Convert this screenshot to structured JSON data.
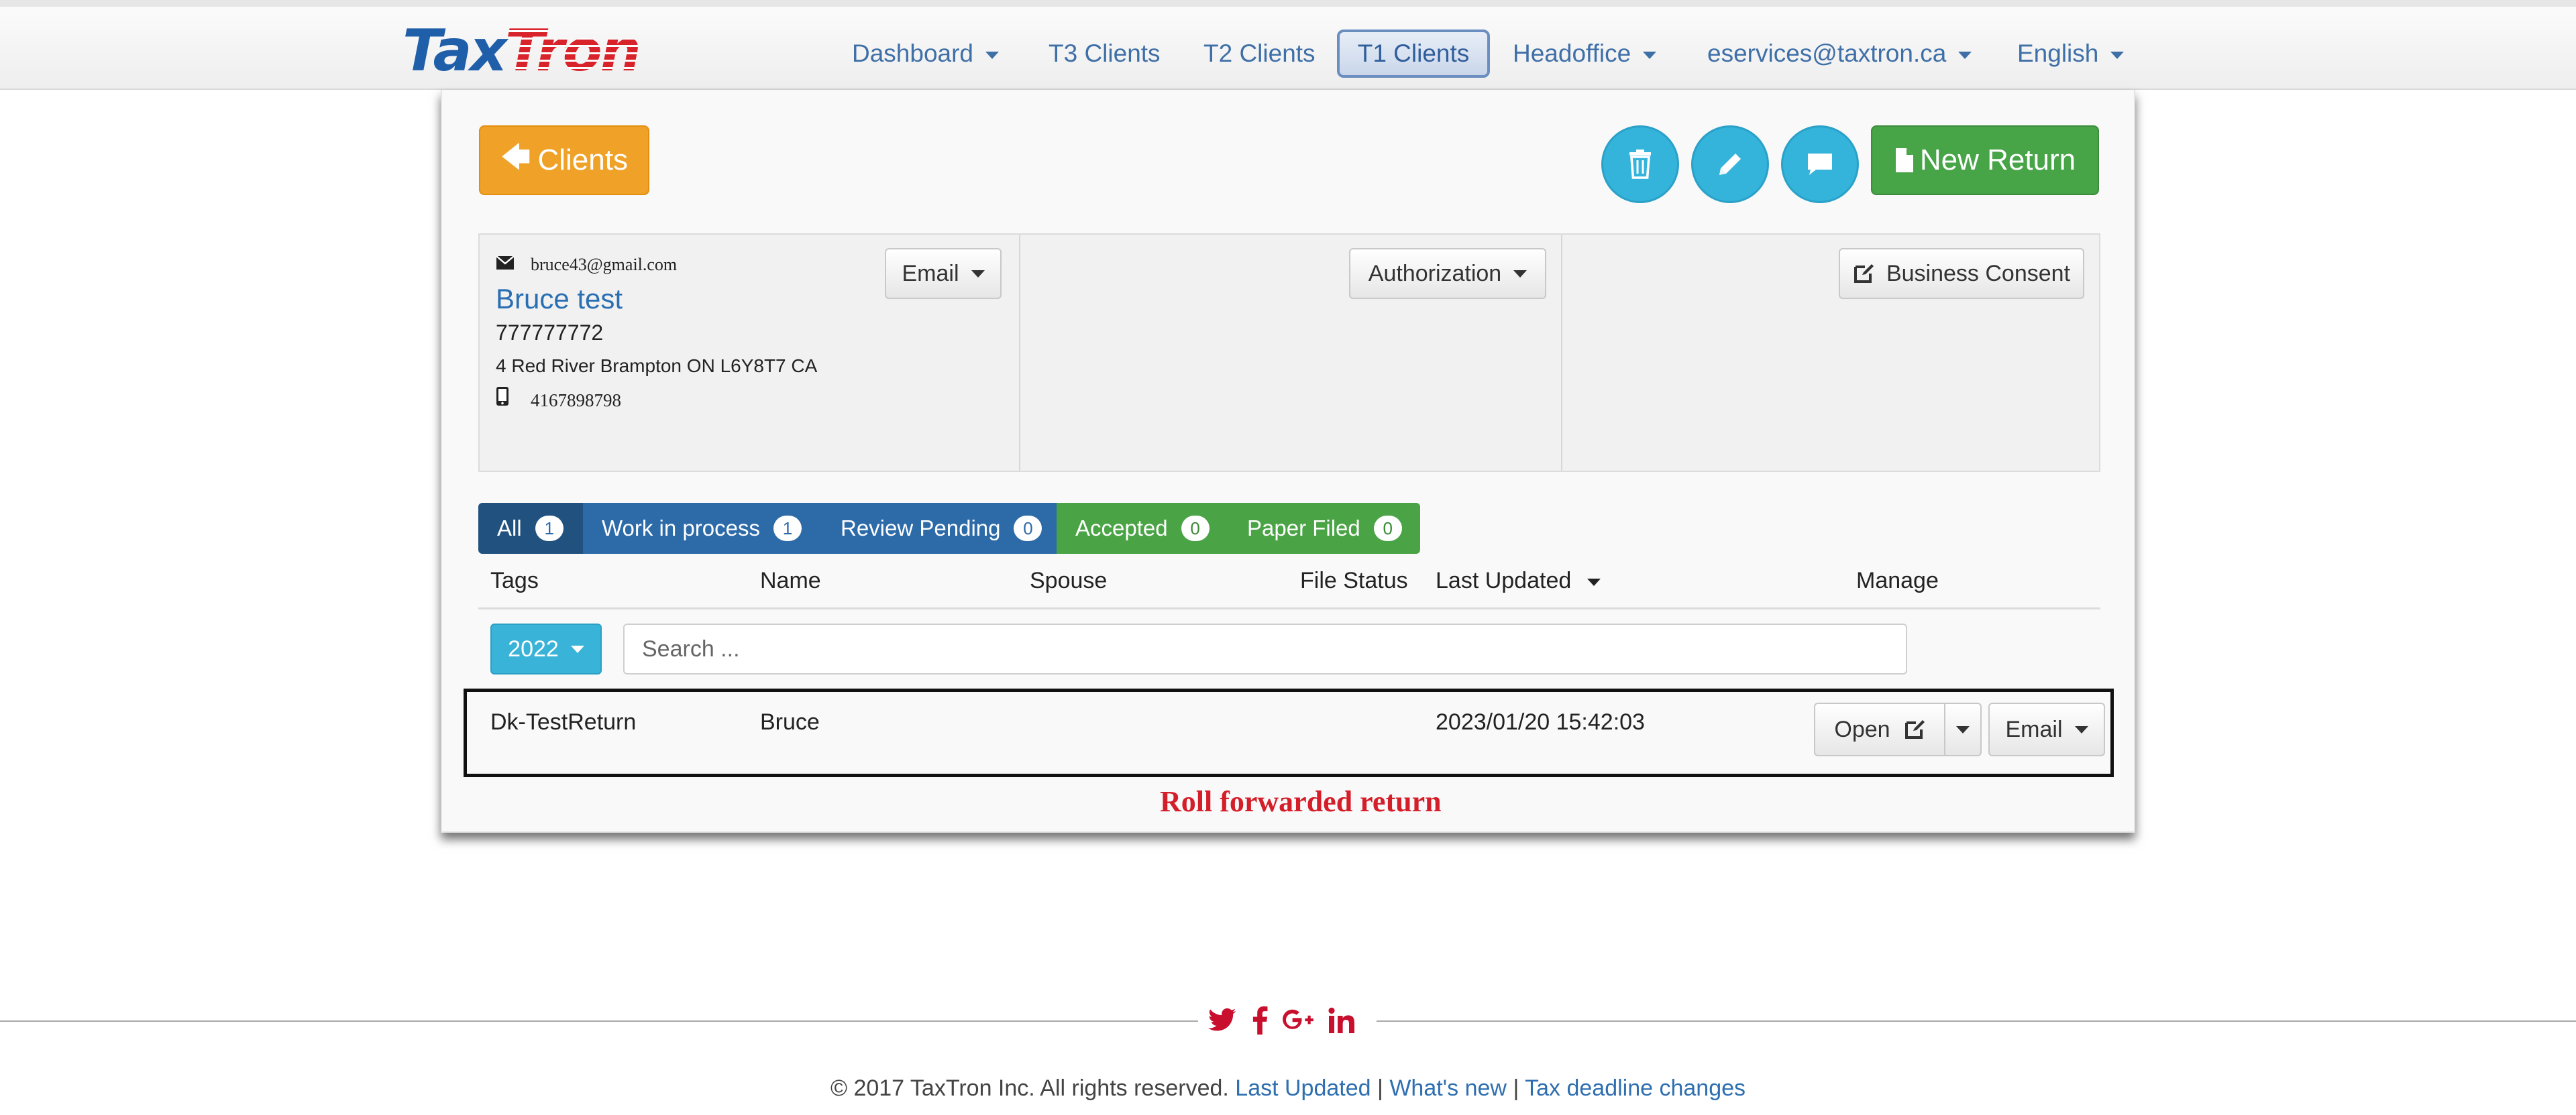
{
  "colors": {
    "brand_blue": "#1f5ea8",
    "brand_red": "#d8232a",
    "orange": "#f0a228",
    "info": "#34b3db",
    "success": "#47a447",
    "primary": "#2c6aa8",
    "annotation_red": "#d41f2a"
  },
  "navbar": {
    "logo": {
      "part1": "Tax",
      "part2": "Tron"
    },
    "items": [
      {
        "label": "Dashboard",
        "dropdown": true
      },
      {
        "label": "T3 Clients",
        "dropdown": false
      },
      {
        "label": "T2 Clients",
        "dropdown": false
      },
      {
        "label": "T1 Clients",
        "dropdown": false,
        "active": true
      },
      {
        "label": "Headoffice",
        "dropdown": true
      },
      {
        "label": "eservices@taxtron.ca",
        "dropdown": true
      },
      {
        "label": "English",
        "dropdown": true
      }
    ]
  },
  "toolbar": {
    "back_label": "Clients",
    "back_icon": "arrow-left-icon",
    "delete_icon": "trash-icon",
    "edit_icon": "pencil-icon",
    "message_icon": "comment-icon",
    "new_return_label": "New Return",
    "new_return_icon": "file-icon"
  },
  "client": {
    "email": "bruce43@gmail.com",
    "name": "Bruce test",
    "sin": "777777772",
    "address": "4 Red River Brampton ON L6Y8T7 CA",
    "phone": "4167898798",
    "email_button": "Email",
    "authorization_button": "Authorization",
    "consent_button": "Business Consent"
  },
  "filters": [
    {
      "label": "All",
      "count": "1"
    },
    {
      "label": "Work in process",
      "count": "1"
    },
    {
      "label": "Review Pending",
      "count": "0"
    },
    {
      "label": "Accepted",
      "count": "0"
    },
    {
      "label": "Paper Filed",
      "count": "0"
    }
  ],
  "table": {
    "headers": [
      "Tags",
      "Name",
      "Spouse",
      "File Status",
      "Last Updated",
      "Manage"
    ],
    "sort_column": "Last Updated",
    "year": "2022",
    "search_placeholder": "Search ...",
    "rows": [
      {
        "tags": "Dk-TestReturn",
        "name": "Bruce",
        "spouse": "",
        "file_status": "",
        "last_updated": "2023/01/20 15:42:03",
        "open_label": "Open",
        "email_label": "Email"
      }
    ]
  },
  "annotation": "Roll forwarded return",
  "footer": {
    "social": [
      "twitter-icon",
      "facebook-icon",
      "google-plus-icon",
      "linkedin-icon"
    ],
    "copyright": "© 2017 TaxTron Inc. All rights reserved.",
    "links": [
      "Last Updated",
      "What's new",
      "Tax deadline changes"
    ],
    "separator": "|"
  }
}
